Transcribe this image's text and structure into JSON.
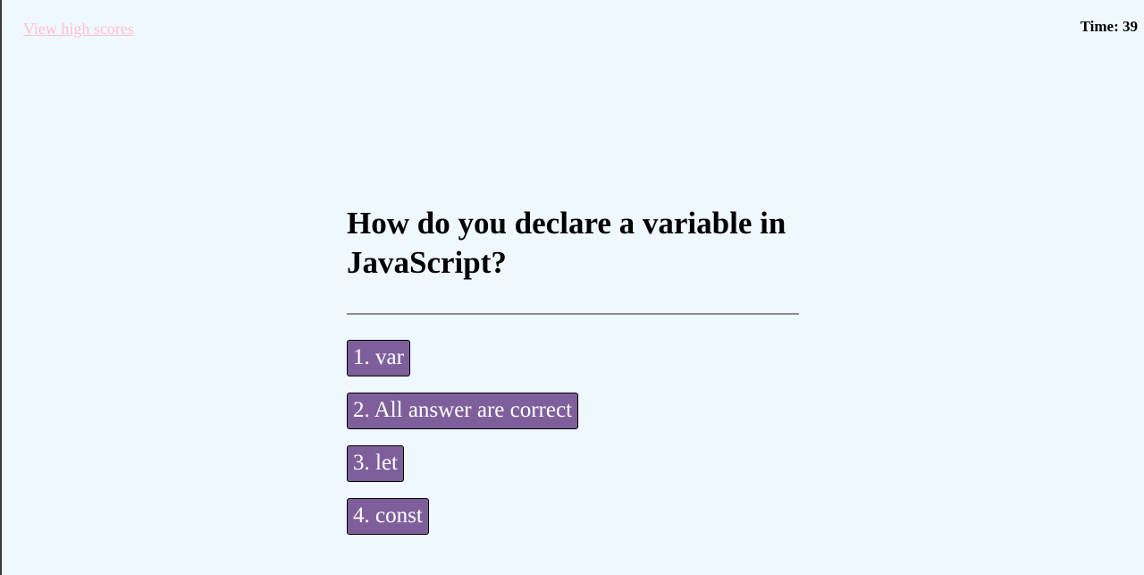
{
  "header": {
    "high_scores_label": "View high scores",
    "timer_label": "Time:",
    "timer_value": "39"
  },
  "quiz": {
    "question": "How do you declare a variable in JavaScript?",
    "answers": [
      {
        "label": "1. var"
      },
      {
        "label": "2. All answer are correct"
      },
      {
        "label": "3. let"
      },
      {
        "label": "4. const"
      }
    ]
  },
  "colors": {
    "background": "#f0f8ff",
    "link": "#ffc0cb",
    "button": "#7e5f9b",
    "button_text": "#ffffff",
    "divider": "#8e8e8e"
  }
}
